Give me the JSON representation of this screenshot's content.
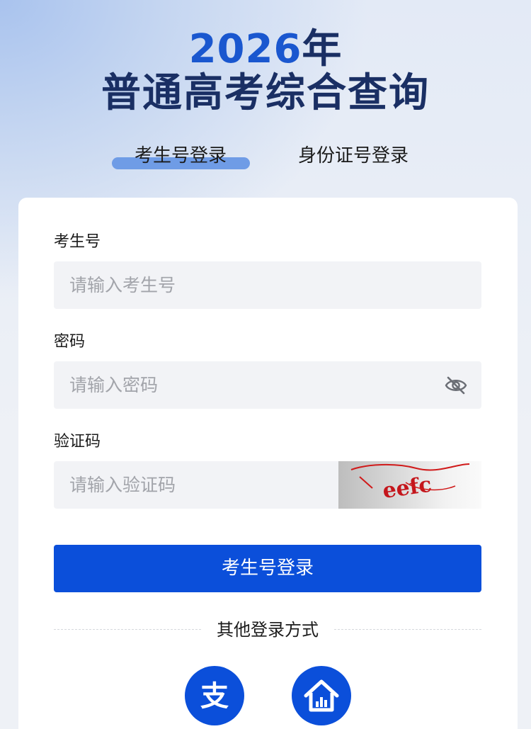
{
  "header": {
    "year": "2026",
    "year_suffix": "年",
    "title": "普通高考综合查询"
  },
  "tabs": [
    {
      "label": "考生号登录",
      "active": true
    },
    {
      "label": "身份证号登录",
      "active": false
    }
  ],
  "form": {
    "student_no": {
      "label": "考生号",
      "placeholder": "请输入考生号",
      "value": ""
    },
    "password": {
      "label": "密码",
      "placeholder": "请输入密码",
      "value": "",
      "toggle_icon": "eye-off-icon"
    },
    "captcha": {
      "label": "验证码",
      "placeholder": "请输入验证码",
      "value": "",
      "image_text": "eefc"
    },
    "submit_label": "考生号登录"
  },
  "other_login": {
    "label": "其他登录方式",
    "methods": [
      {
        "icon": "alipay-icon",
        "glyph": "支"
      },
      {
        "icon": "home-chart-icon"
      }
    ]
  },
  "colors": {
    "primary": "#0b4fda",
    "title_dark": "#1a2f64",
    "year_blue": "#1a57cf",
    "tab_underline": "#6f9ce6"
  }
}
